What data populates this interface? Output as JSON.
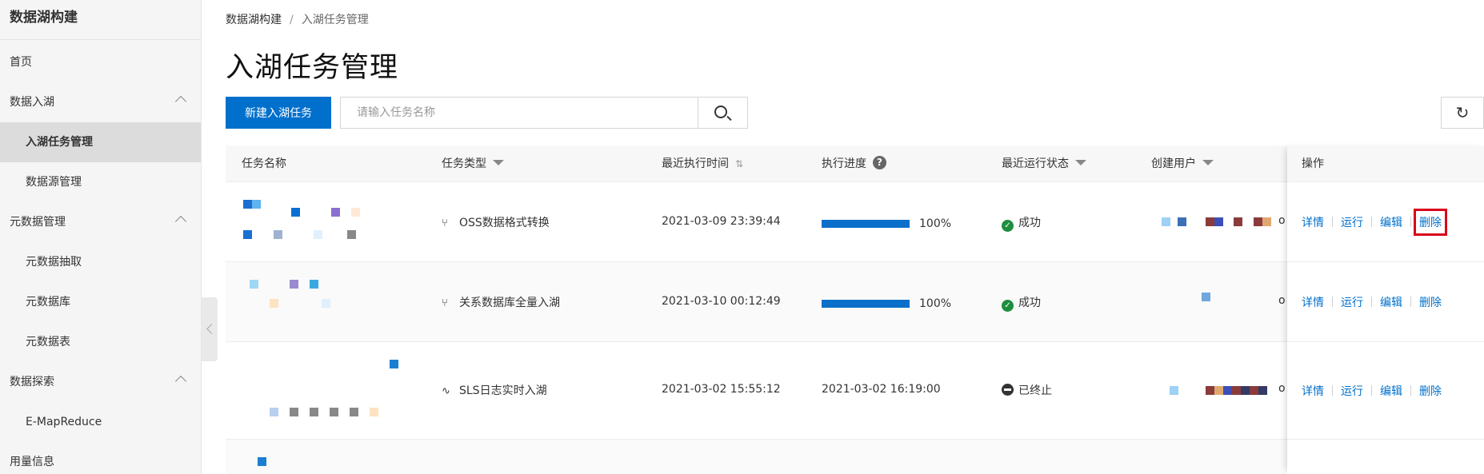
{
  "sidebar": {
    "title": "数据湖构建",
    "items": [
      {
        "label": "首页",
        "type": "top"
      },
      {
        "label": "数据入湖",
        "type": "group"
      },
      {
        "label": "入湖任务管理",
        "type": "sub",
        "active": true
      },
      {
        "label": "数据源管理",
        "type": "sub"
      },
      {
        "label": "元数据管理",
        "type": "group"
      },
      {
        "label": "元数据抽取",
        "type": "sub"
      },
      {
        "label": "元数据库",
        "type": "sub"
      },
      {
        "label": "元数据表",
        "type": "sub"
      },
      {
        "label": "数据探索",
        "type": "group"
      },
      {
        "label": "E-MapReduce",
        "type": "sub"
      },
      {
        "label": "用量信息",
        "type": "top"
      }
    ]
  },
  "breadcrumb": {
    "root": "数据湖构建",
    "sep": "/",
    "current": "入湖任务管理"
  },
  "page": {
    "title": "入湖任务管理"
  },
  "toolbar": {
    "new_task_label": "新建入湖任务",
    "search_placeholder": "请输入任务名称",
    "refresh_icon": "↻"
  },
  "table": {
    "columns": {
      "name": "任务名称",
      "type": "任务类型",
      "last_run": "最近执行时间",
      "progress": "执行进度",
      "status": "最近运行状态",
      "creator": "创建用户",
      "ops": "操作"
    },
    "rows": [
      {
        "type": "OSS数据格式转换",
        "type_icon": "branch-icon",
        "last_run": "2021-03-09 23:39:44",
        "progress": 100,
        "progress_text": "100%",
        "status": "成功",
        "status_kind": "success",
        "creator_suffix": "o"
      },
      {
        "type": "关系数据库全量入湖",
        "type_icon": "branch-icon",
        "last_run": "2021-03-10 00:12:49",
        "progress": 100,
        "progress_text": "100%",
        "status": "成功",
        "status_kind": "success",
        "creator_suffix": "o"
      },
      {
        "type": "SLS日志实时入湖",
        "type_icon": "pulse-icon",
        "last_run": "2021-03-02 15:55:12",
        "end_time": "2021-03-02 16:19:00",
        "status": "已终止",
        "status_kind": "stopped",
        "creator_suffix": "o"
      }
    ],
    "ops": {
      "detail": "详情",
      "run": "运行",
      "edit": "编辑",
      "delete": "删除"
    }
  },
  "colors": {
    "primary": "#0070cc",
    "success": "#1e8e3e",
    "highlight": "#d9001b"
  }
}
